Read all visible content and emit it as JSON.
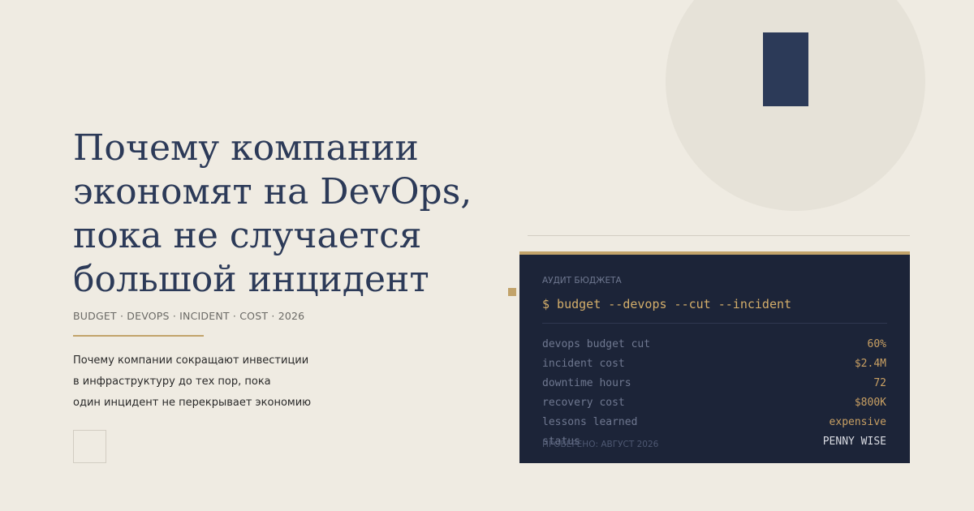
{
  "headline": {
    "lines": [
      "Почему компании",
      "экономят на DevOps,",
      "пока не случается",
      "большой инцидент"
    ]
  },
  "tags": "BUDGET · DEVOPS · INCIDENT · COST · 2026",
  "description": {
    "lines": [
      "Почему компании сокращают инвестиции",
      "в инфраструктуру до тех пор, пока",
      "один инцидент не перекрывает экономию"
    ]
  },
  "terminal": {
    "label": "Аудит бюджета",
    "command": "$ budget --devops --cut --incident",
    "rows": [
      {
        "key": "devops budget cut",
        "value": "60%"
      },
      {
        "key": "incident cost",
        "value": "$2.4M"
      },
      {
        "key": "downtime hours",
        "value": "72"
      },
      {
        "key": "recovery cost",
        "value": "$800K"
      },
      {
        "key": "lessons learned",
        "value": "expensive"
      },
      {
        "key": "status",
        "value": "PENNY WISE"
      }
    ],
    "footer": "Проверено: август 2026"
  },
  "colors": {
    "background": "#efebe2",
    "navy": "#2c3a58",
    "gold": "#c2a36a",
    "terminal_bg": "#1c2438"
  }
}
